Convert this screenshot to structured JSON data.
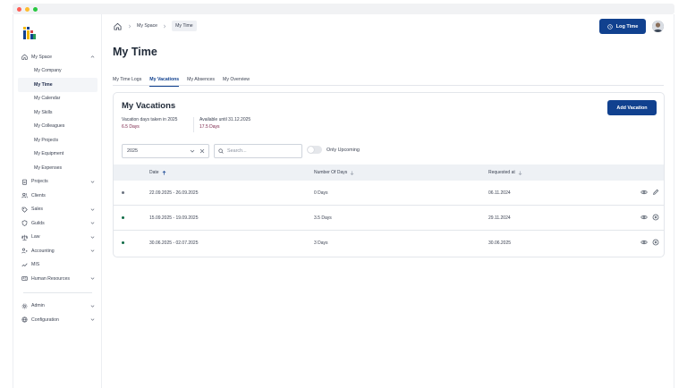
{
  "window": {
    "dot_colors": [
      "#ff5f57",
      "#febc2e",
      "#28c840"
    ]
  },
  "sidebar": {
    "items": [
      {
        "label": "My Space",
        "icon": "home-icon",
        "expanded": true
      },
      {
        "label": "My Company",
        "sub": true
      },
      {
        "label": "My Time",
        "sub": true,
        "active": true
      },
      {
        "label": "My Calendar",
        "sub": true
      },
      {
        "label": "My Skills",
        "sub": true
      },
      {
        "label": "My Colleagues",
        "sub": true
      },
      {
        "label": "My Projects",
        "sub": true
      },
      {
        "label": "My Equipment",
        "sub": true
      },
      {
        "label": "My Expenses",
        "sub": true
      },
      {
        "label": "Projects",
        "icon": "clipboard-icon",
        "chevron": true
      },
      {
        "label": "Clients",
        "icon": "users-icon"
      },
      {
        "label": "Sales",
        "icon": "tag-icon",
        "chevron": true
      },
      {
        "label": "Guilds",
        "icon": "shield-icon",
        "chevron": true
      },
      {
        "label": "Law",
        "icon": "law-icon",
        "chevron": true
      },
      {
        "label": "Accounting",
        "icon": "accounting-icon",
        "chevron": true
      },
      {
        "label": "MIS",
        "icon": "chart-icon"
      },
      {
        "label": "Human Resources",
        "icon": "id-card-icon",
        "chevron": true
      },
      {
        "label": "Admin",
        "icon": "gear-icon",
        "chevron": true
      },
      {
        "label": "Configuration",
        "icon": "globe-icon",
        "chevron": true
      }
    ]
  },
  "breadcrumb": {
    "items": [
      "My Space",
      "My Time"
    ]
  },
  "header": {
    "log_time_label": "Log Time"
  },
  "page": {
    "title": "My Time"
  },
  "tabs": [
    {
      "label": "My Time Logs"
    },
    {
      "label": "My Vacations",
      "active": true
    },
    {
      "label": "My Absences"
    },
    {
      "label": "My Overview"
    }
  ],
  "vacations": {
    "title": "My Vacations",
    "taken_label": "Vacation days taken in 2025",
    "taken_value": "6.5 Days",
    "available_label": "Available until 31.12.2025",
    "available_value": "17.5 Days",
    "add_label": "Add Vacation",
    "filter_year": "2025",
    "search_placeholder": "Search...",
    "only_upcoming_label": "Only Upcoming",
    "columns": {
      "date": "Date",
      "days": "Number Of Days",
      "requested": "Requested at"
    },
    "rows": [
      {
        "date": "22.09.2025 - 26.09.2025",
        "days": "0 Days",
        "requested": "06.11.2024",
        "status_color": "#6b7280",
        "action": "edit-icon"
      },
      {
        "date": "15.09.2025 - 19.09.2025",
        "days": "3.5 Days",
        "requested": "29.11.2024",
        "status_color": "#0f6b46",
        "action": "cancel-icon"
      },
      {
        "date": "30.06.2025 - 02.07.2025",
        "days": "3 Days",
        "requested": "30.06.2025",
        "status_color": "#0f6b46",
        "action": "cancel-icon"
      }
    ]
  },
  "colors": {
    "primary": "#11418f",
    "accent_value": "#7a2248"
  }
}
